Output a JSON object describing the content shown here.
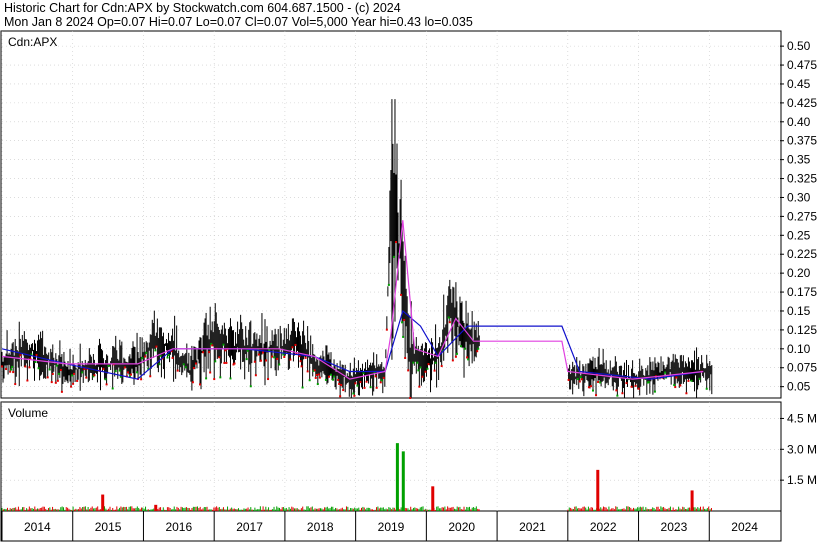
{
  "header": {
    "title_line": "Historic Chart for Cdn:APX by Stockwatch.com 604.687.1500 - (c) 2024",
    "quote_line": "Mon Jan  8 2024  Op=0.07  Hi=0.07  Lo=0.07  Cl=0.07  Vol=5,000  Year hi=0.43  lo=0.035"
  },
  "price_panel": {
    "label": "Cdn:APX"
  },
  "volume_panel": {
    "label": "Volume"
  },
  "colors": {
    "price_bars": "#000000",
    "moving_avg_short": "#e040e0",
    "moving_avg_long": "#1010cc",
    "down_marks": "#e00000",
    "up_marks": "#00a000",
    "grid": "#c8c8c8"
  },
  "chart_data": [
    {
      "type": "line",
      "title": "Cdn:APX",
      "x_axis": {
        "categories": [
          "2014",
          "2015",
          "2016",
          "2017",
          "2018",
          "2019",
          "2020",
          "2021",
          "2022",
          "2023",
          "2024"
        ]
      },
      "y_axis": {
        "ylim": [
          0.035,
          0.52
        ],
        "ticks": [
          "0.50",
          "0.475",
          "0.45",
          "0.425",
          "0.40",
          "0.375",
          "0.35",
          "0.325",
          "0.30",
          "0.275",
          "0.25",
          "0.225",
          "0.20",
          "0.175",
          "0.15",
          "0.125",
          "0.10",
          "0.075",
          "0.05"
        ],
        "position": "right"
      },
      "grid": true,
      "series": [
        {
          "kind": "close",
          "points": [
            [
              "2014-01",
              0.08
            ],
            [
              "2014-06",
              0.1
            ],
            [
              "2014-12",
              0.07
            ],
            [
              "2015-06",
              0.08
            ],
            [
              "2015-12",
              0.08
            ],
            [
              "2016-03",
              0.11
            ],
            [
              "2016-06",
              0.1
            ],
            [
              "2016-09",
              0.07
            ],
            [
              "2016-12",
              0.11
            ],
            [
              "2017-06",
              0.1
            ],
            [
              "2017-12",
              0.1
            ],
            [
              "2018-03",
              0.11
            ],
            [
              "2018-06",
              0.08
            ],
            [
              "2018-12",
              0.06
            ],
            [
              "2019-03",
              0.07
            ],
            [
              "2019-06",
              0.07
            ],
            [
              "2019-07",
              0.3
            ],
            [
              "2019-08",
              0.27
            ],
            [
              "2019-10",
              0.1
            ],
            [
              "2019-12",
              0.08
            ],
            [
              "2020-03",
              0.09
            ],
            [
              "2020-05",
              0.15
            ],
            [
              "2020-07",
              0.12
            ],
            [
              "2020-09",
              0.11
            ],
            [
              "2022-01",
              0.06
            ],
            [
              "2022-06",
              0.07
            ],
            [
              "2022-12",
              0.06
            ],
            [
              "2023-06",
              0.07
            ],
            [
              "2024-01",
              0.07
            ]
          ]
        },
        {
          "kind": "short moving average",
          "points": [
            [
              "2014-01",
              0.09
            ],
            [
              "2014-12",
              0.08
            ],
            [
              "2015-12",
              0.08
            ],
            [
              "2016-06",
              0.1
            ],
            [
              "2016-12",
              0.1
            ],
            [
              "2017-12",
              0.1
            ],
            [
              "2018-06",
              0.09
            ],
            [
              "2018-12",
              0.06
            ],
            [
              "2019-06",
              0.07
            ],
            [
              "2019-07",
              0.12
            ],
            [
              "2019-09",
              0.27
            ],
            [
              "2019-11",
              0.1
            ],
            [
              "2020-03",
              0.09
            ],
            [
              "2020-06",
              0.14
            ],
            [
              "2020-09",
              0.11
            ],
            [
              "2021-12",
              0.11
            ],
            [
              "2022-01",
              0.07
            ],
            [
              "2022-12",
              0.06
            ],
            [
              "2023-12",
              0.07
            ]
          ]
        },
        {
          "kind": "long moving average",
          "points": [
            [
              "2014-01",
              0.1
            ],
            [
              "2014-12",
              0.08
            ],
            [
              "2015-12",
              0.06
            ],
            [
              "2016-06",
              0.1
            ],
            [
              "2017-06",
              0.1
            ],
            [
              "2018-06",
              0.09
            ],
            [
              "2018-12",
              0.07
            ],
            [
              "2019-06",
              0.07
            ],
            [
              "2019-09",
              0.15
            ],
            [
              "2019-12",
              0.13
            ],
            [
              "2020-03",
              0.09
            ],
            [
              "2020-08",
              0.13
            ],
            [
              "2021-12",
              0.13
            ],
            [
              "2022-03",
              0.07
            ],
            [
              "2023-03",
              0.06
            ],
            [
              "2023-12",
              0.07
            ]
          ]
        }
      ],
      "annotations": {
        "year_high": 0.43,
        "year_low": 0.035
      }
    },
    {
      "type": "bar",
      "title": "Volume",
      "y_axis": {
        "ticks": [
          "4.5 M",
          "3.0 M",
          "1.5 M"
        ],
        "position": "right"
      },
      "spikes": [
        [
          "2015-06",
          0.8
        ],
        [
          "2016-03",
          0.3
        ],
        [
          "2019-08",
          3.3
        ],
        [
          "2019-09",
          2.9
        ],
        [
          "2020-02",
          1.2
        ],
        [
          "2022-06",
          2.0
        ],
        [
          "2023-10",
          1.0
        ]
      ]
    }
  ]
}
